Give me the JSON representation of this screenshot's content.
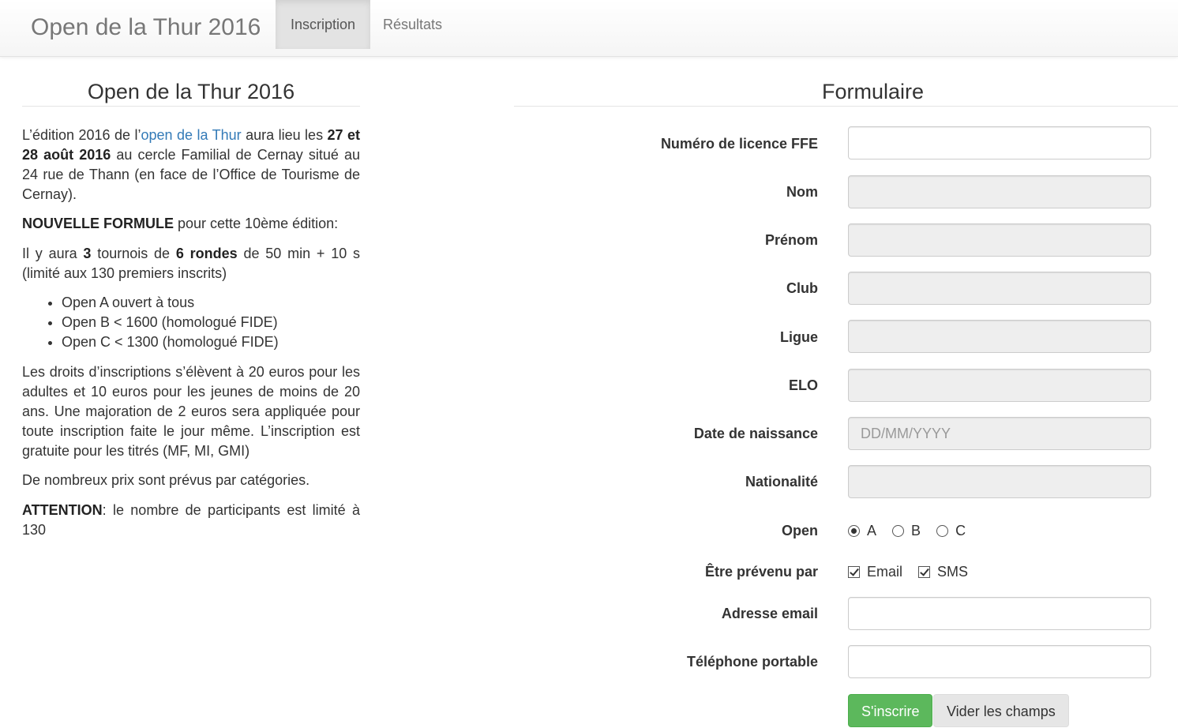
{
  "navbar": {
    "brand": "Open de la Thur 2016",
    "tabs": [
      {
        "label": "Inscription",
        "active": true
      },
      {
        "label": "Résultats",
        "active": false
      }
    ]
  },
  "info": {
    "title": "Open de la Thur 2016",
    "p1_a": "L’édition 2016 de l’",
    "p1_link": "open de la Thur",
    "p1_b": " aura lieu les ",
    "p1_bold": "27 et 28 août 2016",
    "p1_c": " au cercle Familial de Cernay situé au 24 rue de Thann (en face de l’Office de Tourisme de Cernay).",
    "p2_bold": "NOUVELLE FORMULE",
    "p2_rest": " pour cette 10ème édition:",
    "p3_a": "Il y aura ",
    "p3_b1": "3",
    "p3_c": " tournois de ",
    "p3_b2": "6 rondes",
    "p3_d": " de 50 min + 10 s (limité aux 130 premiers inscrits)",
    "opens": [
      "Open A ouvert à tous",
      "Open B < 1600 (homologué FIDE)",
      "Open C < 1300 (homologué FIDE)"
    ],
    "p4": "Les droits d’inscriptions s’élèvent à 20 euros pour les adultes et 10 euros pour les jeunes de moins de 20 ans. Une majoration de 2 euros sera appliquée pour toute inscription faite le jour même. L’inscription est gratuite pour les titrés (MF, MI, GMI)",
    "p5": "De nombreux prix sont prévus par catégories.",
    "p6_bold": "ATTENTION",
    "p6_rest": ": le nombre de participants est limité à 130"
  },
  "form": {
    "title": "Formulaire",
    "labels": {
      "licence": "Numéro de licence FFE",
      "nom": "Nom",
      "prenom": "Prénom",
      "club": "Club",
      "ligue": "Ligue",
      "elo": "ELO",
      "naissance": "Date de naissance",
      "nationalite": "Nationalité",
      "open": "Open",
      "prevenu": "Être prévenu par",
      "email": "Adresse email",
      "telephone": "Téléphone portable"
    },
    "naissance_placeholder": "DD/MM/YYYY",
    "open_options": [
      {
        "label": "A",
        "checked": true
      },
      {
        "label": "B",
        "checked": false
      },
      {
        "label": "C",
        "checked": false
      }
    ],
    "notify_options": [
      {
        "label": "Email",
        "checked": true
      },
      {
        "label": "SMS",
        "checked": true
      }
    ],
    "submit_label": "S'inscrire",
    "reset_label": "Vider les champs"
  }
}
